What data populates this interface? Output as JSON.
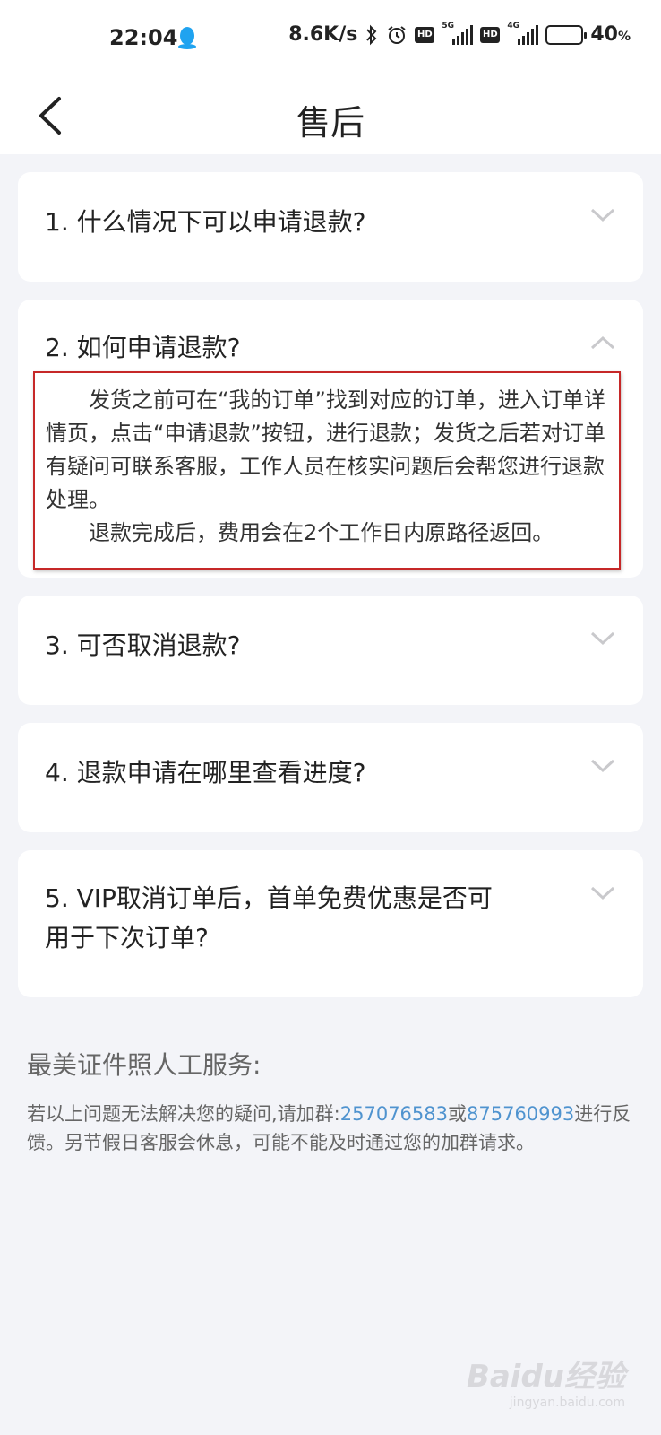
{
  "status_bar": {
    "time": "22:04",
    "net_speed": "8.6K/s",
    "signal1_label": "5G",
    "signal2_label": "4G",
    "hd_label": "HD",
    "battery_percent": "40",
    "battery_unit": "%",
    "battery_level": 0.4
  },
  "nav": {
    "title": "售后"
  },
  "faq": [
    {
      "question": "1. 什么情况下可以申请退款?",
      "expanded": false
    },
    {
      "question": "2. 如何申请退款?",
      "expanded": true,
      "answer_p1": "发货之前可在“我的订单”找到对应的订单，进入订单详情页，点击“申请退款”按钮，进行退款；发货之后若对订单有疑问可联系客服，工作人员在核实问题后会帮您进行退款处理。",
      "answer_p2": "退款完成后，费用会在2个工作日内原路径返回。"
    },
    {
      "question": "3. 可否取消退款?",
      "expanded": false
    },
    {
      "question": "4. 退款申请在哪里查看进度?",
      "expanded": false
    },
    {
      "question_line1": "5. VIP取消订单后，首单免费优惠是否可",
      "question_line2": "用于下次订单?",
      "expanded": false
    }
  ],
  "service": {
    "title": "最美证件照人工服务:",
    "text_before": "若以上问题无法解决您的疑问,请加群:",
    "group1": "257076583",
    "or": "或",
    "group2": "875760993",
    "text_after": "进行反馈。另节假日客服会休息，可能不能及时通过您的加群请求。"
  },
  "watermark": {
    "brand": "Baidu",
    "sub": "经验",
    "url": "jingyan.baidu.com"
  },
  "colors": {
    "accent_link": "#4f93cf",
    "highlight_border": "#c62828",
    "background": "#f3f4f8"
  }
}
